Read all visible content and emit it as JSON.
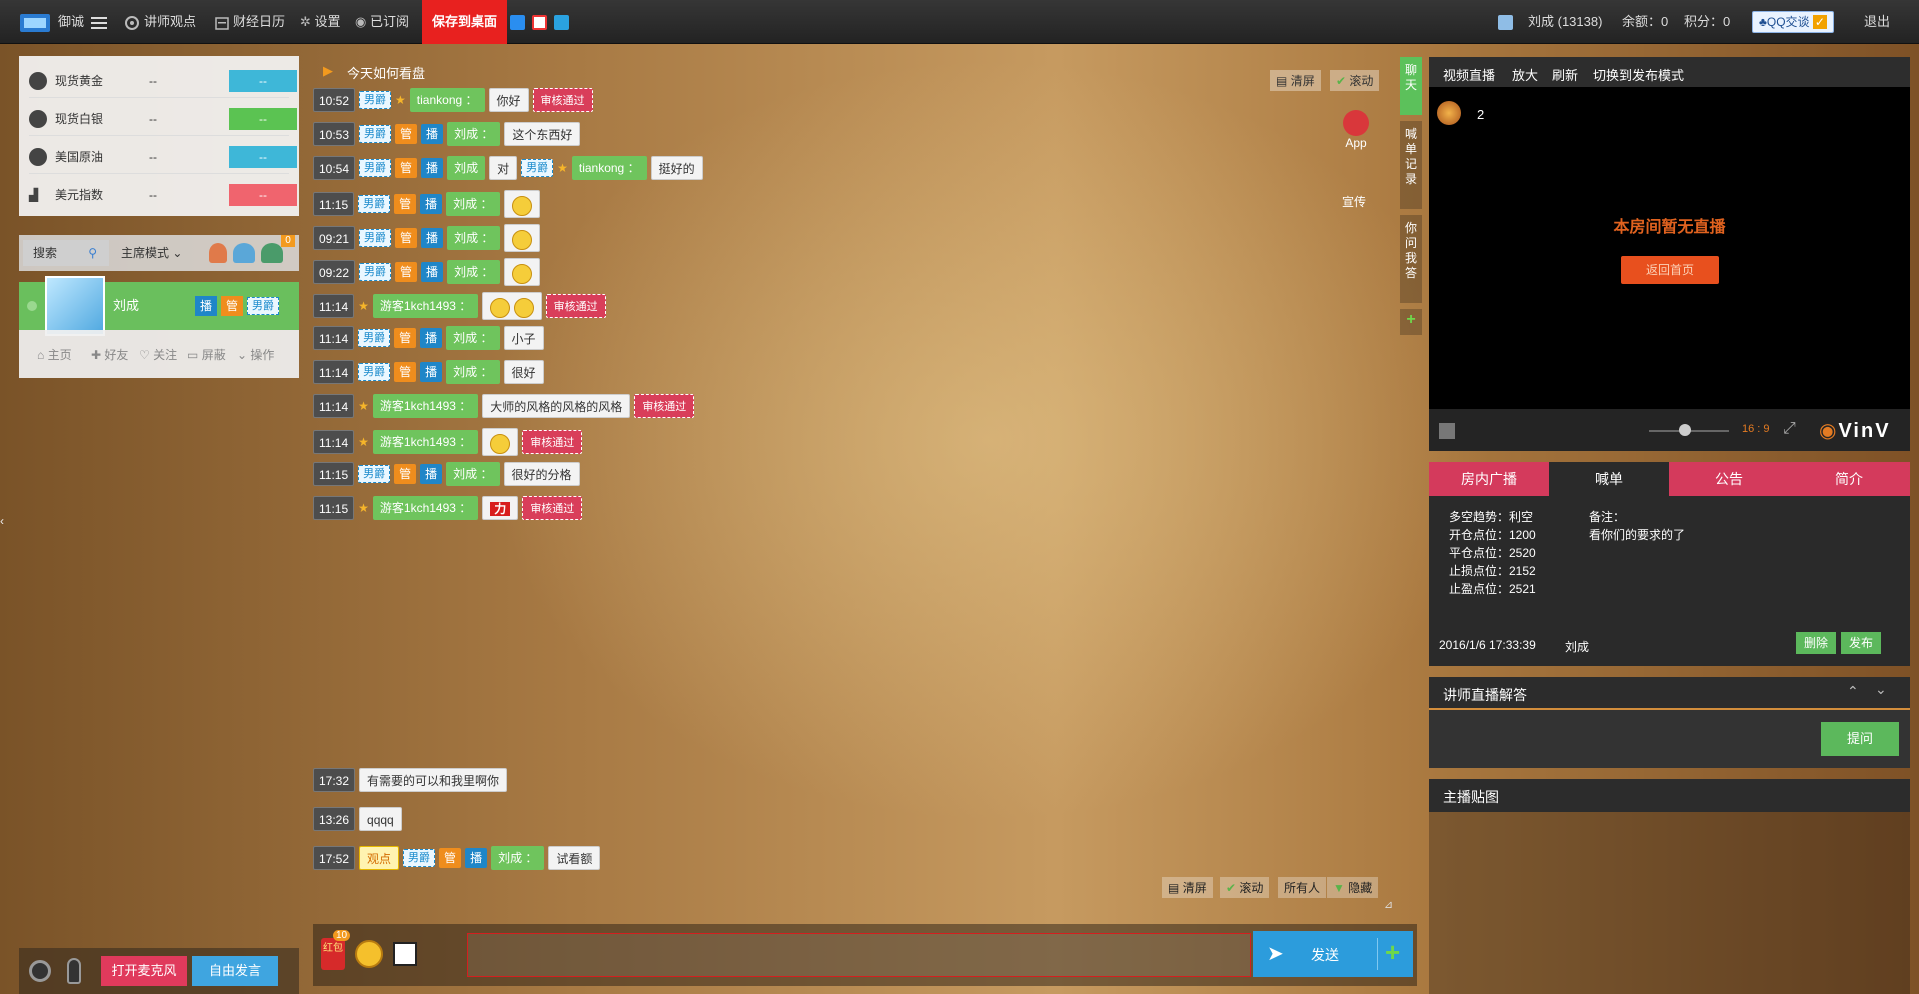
{
  "topbar": {
    "brand": "御诚",
    "nav": [
      "讲师观点",
      "财经日历",
      "设置",
      "已订阅"
    ],
    "save_desktop": "保存到桌面",
    "user": "刘成 (13138)",
    "balance": "余额：0",
    "points": "积分：0",
    "qq": "QQ交谈",
    "logout": "退出"
  },
  "quotes": [
    {
      "name": "现货黄金",
      "value": "--",
      "badge": "--",
      "color": "#3eb7d8"
    },
    {
      "name": "现货白银",
      "value": "--",
      "badge": "--",
      "color": "#5bc352"
    },
    {
      "name": "美国原油",
      "value": "--",
      "badge": "--",
      "color": "#3eb7d8"
    },
    {
      "name": "美元指数",
      "value": "--",
      "badge": "--",
      "color": "#f0646e"
    }
  ],
  "left": {
    "search": "搜索",
    "mode": "主席模式",
    "online_badge": "0",
    "user_name": "刘成",
    "tags": [
      "播",
      "管",
      "男爵"
    ],
    "actions": [
      "主页",
      "好友",
      "关注",
      "屏蔽",
      "操作"
    ],
    "mic_button": "打开麦克风",
    "free_speak": "自由发言"
  },
  "chat": {
    "title": "今天如何看盘",
    "clear": "清屏",
    "scroll": "滚动",
    "app": "App",
    "promo": "宣传",
    "messages": [
      {
        "time": "10:52",
        "user": "tiankong ：",
        "text": "你好",
        "approved": "审核通过"
      },
      {
        "time": "10:53",
        "user": "刘成 ：",
        "text": "这个东西好"
      },
      {
        "time": "10:54",
        "user": "刘成",
        "to": "对",
        "to_user": "tiankong ：",
        "text": "挺好的"
      },
      {
        "time": "11:15",
        "user": "刘成 ："
      },
      {
        "time": "09:21",
        "user": "刘成 ："
      },
      {
        "time": "09:22",
        "user": "刘成 ："
      },
      {
        "time": "11:14",
        "user": "游客1kch1493 ：",
        "approved": "审核通过"
      },
      {
        "time": "11:14",
        "user": "刘成 ：",
        "text": "小子"
      },
      {
        "time": "11:14",
        "user": "刘成 ：",
        "text": "很好"
      },
      {
        "time": "11:14",
        "user": "游客1kch1493 ：",
        "text": "大师的风格的风格的风格",
        "approved": "审核通过"
      },
      {
        "time": "11:14",
        "user": "游客1kch1493 ：",
        "approved": "审核通过"
      },
      {
        "time": "11:15",
        "user": "刘成 ：",
        "text": "很好的分格"
      },
      {
        "time": "11:15",
        "user": "游客1kch1493 ：",
        "gift": "力",
        "approved": "审核通过"
      }
    ],
    "late": [
      {
        "time": "17:32",
        "text": "有需要的可以和我里啊你"
      },
      {
        "time": "13:26",
        "text": "qqqq"
      },
      {
        "time": "17:52",
        "tag": "观点",
        "user": "刘成 ：",
        "text": "试看额"
      }
    ],
    "level": "男爵",
    "guan": "管",
    "bo": "播",
    "footer": {
      "clear": "清屏",
      "scroll": "滚动",
      "all": "所有人",
      "hide": "隐藏"
    },
    "send": "发送",
    "hongbao_count": "10",
    "hongbao_label": "红包"
  },
  "vtabs": [
    "聊天",
    "喊单记录",
    "你问我答"
  ],
  "video": {
    "head": [
      "视频直播",
      "放大",
      "刷新",
      "切换到发布模式"
    ],
    "viewers": "2",
    "no_live": "本房间暂无直播",
    "back_home": "返回首页",
    "ratio": "16 : 9",
    "logo": "VinV"
  },
  "info": {
    "tabs": [
      "房内广播",
      "喊单",
      "公告",
      "简介"
    ],
    "active": 1,
    "lines": [
      "多空趋势：利空",
      "开仓点位：1200",
      "平仓点位：2520",
      "止损点位：2152",
      "止盈点位：2521"
    ],
    "note_label": "备注：",
    "note": "看你们的要求的了",
    "datetime": "2016/1/6 17:33:39",
    "author": "刘成",
    "delete": "删除",
    "publish": "发布"
  },
  "qa": {
    "title": "讲师直播解答",
    "ask": "提问"
  },
  "paste": {
    "title": "主播贴图"
  }
}
